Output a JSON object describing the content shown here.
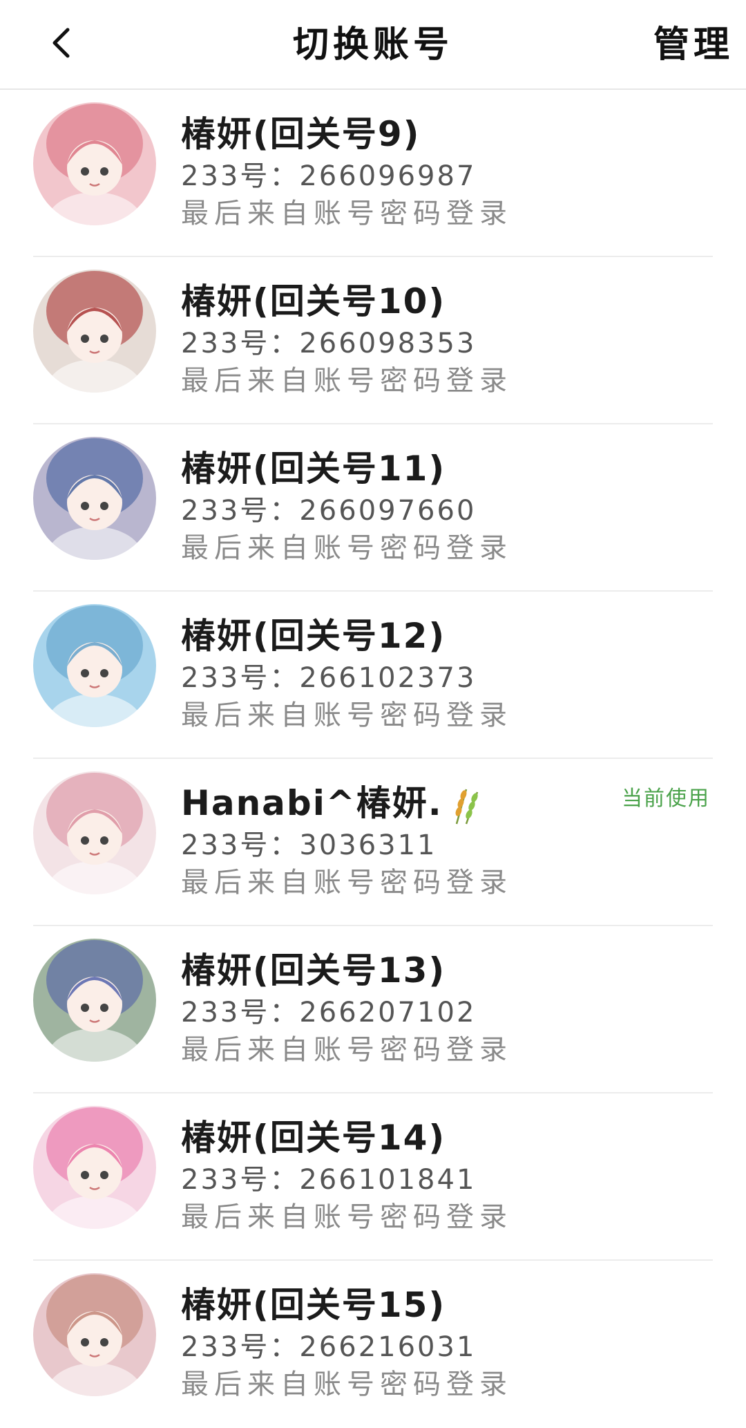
{
  "header": {
    "title": "切换账号",
    "manage_label": "管理"
  },
  "accounts": [
    {
      "name": "椿妍(回关号9)",
      "id_text": "233号：266096987",
      "login_text": "最后来自账号密码登录",
      "avatar_bg": "#f2c6cc",
      "avatar_accent": "#d96a7a",
      "current": false
    },
    {
      "name": "椿妍(回关号10)",
      "id_text": "233号：266098353",
      "login_text": "最后来自账号密码登录",
      "avatar_bg": "#e6dcd6",
      "avatar_accent": "#a52a2a",
      "current": false
    },
    {
      "name": "椿妍(回关号11)",
      "id_text": "233号：266097660",
      "login_text": "最后来自账号密码登录",
      "avatar_bg": "#b9b6cf",
      "avatar_accent": "#3c5a9a",
      "current": false
    },
    {
      "name": "椿妍(回关号12)",
      "id_text": "233号：266102373",
      "login_text": "最后来自账号密码登录",
      "avatar_bg": "#a8d4ec",
      "avatar_accent": "#5a9cc8",
      "current": false
    },
    {
      "name": "Hanabi^椿妍.",
      "id_text": "233号：3036311",
      "login_text": "最后来自账号密码登录",
      "avatar_bg": "#f3e3e6",
      "avatar_accent": "#d98a9a",
      "current": true,
      "current_label": "当前使用"
    },
    {
      "name": "椿妍(回关号13)",
      "id_text": "233号：266207102",
      "login_text": "最后来自账号密码登录",
      "avatar_bg": "#9fb4a0",
      "avatar_accent": "#4a5aa8",
      "current": false
    },
    {
      "name": "椿妍(回关号14)",
      "id_text": "233号：266101841",
      "login_text": "最后来自账号密码登录",
      "avatar_bg": "#f6d6e4",
      "avatar_accent": "#e86aa0",
      "current": false
    },
    {
      "name": "椿妍(回关号15)",
      "id_text": "233号：266216031",
      "login_text": "最后来自账号密码登录",
      "avatar_bg": "#e8c8cc",
      "avatar_accent": "#c08070",
      "current": false
    }
  ],
  "colors": {
    "current_badge": "#4aa24a",
    "divider": "#ececec"
  }
}
